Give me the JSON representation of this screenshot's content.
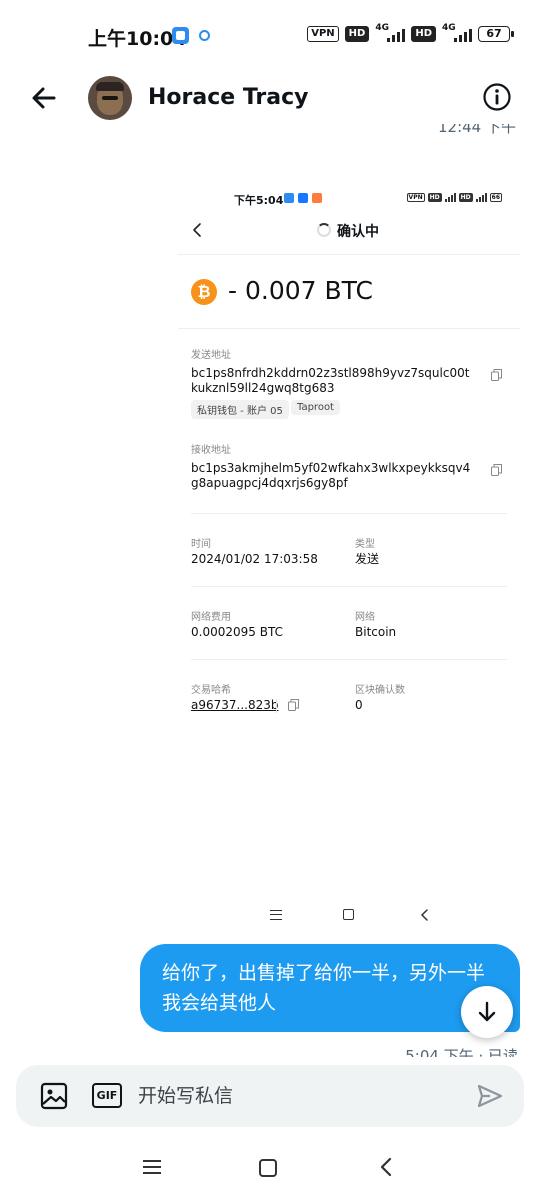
{
  "status_bar": {
    "time": "上午10:04",
    "vpn": "VPN",
    "hd1": "HD",
    "net1": "4G",
    "hd2": "HD",
    "net2": "4G",
    "battery": "67"
  },
  "header": {
    "contact_name": "Horace Tracy",
    "icons": [
      "back-arrow-icon",
      "avatar",
      "info-icon"
    ]
  },
  "conversation": {
    "previous_timestamp_partial": "12:44 下午"
  },
  "attachment_screenshot": {
    "status_time": "下午5:04",
    "battery": "66",
    "page_title": "确认中",
    "amount": "- 0.007 BTC",
    "coin_symbol": "₿",
    "sender_label": "发送地址",
    "sender_address": "bc1ps8nfrdh2kddrn02z3stl898h9yvz7squlc00tkukznl59ll24gwq8tg683",
    "sender_wallet_tag": "私钥钱包 - 账户 05",
    "sender_type_tag": "Taproot",
    "receiver_label": "接收地址",
    "receiver_address": "bc1ps3akmjhelm5yf02wfkahx3wlkxpeykksqv4g8apuagpcj4dqxrjs6gy8pf",
    "time_label": "时间",
    "time_value": "2024/01/02 17:03:58",
    "type_label": "类型",
    "type_value": "发送",
    "fee_label": "网络费用",
    "fee_value": "0.0002095 BTC",
    "network_label": "网络",
    "network_value": "Bitcoin",
    "hash_label": "交易哈希",
    "hash_value": "a96737...823b",
    "confirmations_label": "区块确认数",
    "confirmations_value": "0"
  },
  "message": {
    "text": "给你了，出售掉了给你一半，另外一半我会给其他人",
    "receipt_partial": "5:04 下午 · 已读"
  },
  "composer": {
    "placeholder": "开始写私信",
    "gif_label": "GIF"
  },
  "colors": {
    "accent": "#1d9bf0",
    "bitcoin": "#f7931a",
    "composer_bg": "#eff3f4"
  }
}
